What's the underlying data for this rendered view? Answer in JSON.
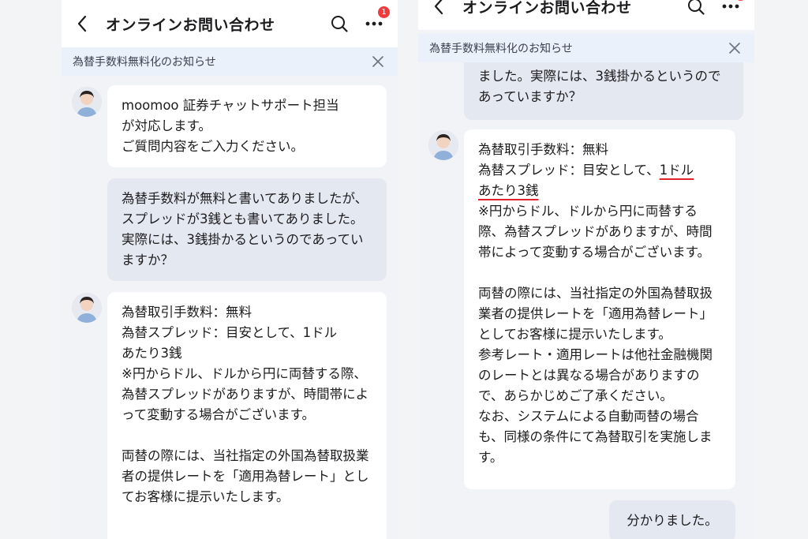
{
  "header": {
    "title": "オンラインお問い合わせ",
    "notification_count": "1"
  },
  "notice": {
    "text": "為替手数料無料化のお知らせ"
  },
  "left_chat": {
    "agent_greeting": "moomoo 証券チャットサポート担当\nが対応します。\n ご質問内容をご入力ください。",
    "user_question": "為替手数料が無料と書いてありましたが、スプレッドが3銭とも書いてありました。実際には、3銭掛かるというのであっていますか？",
    "agent_answer_partial": "為替取引手数料：無料\n為替スプレッド：目安として、1ドル\nあたり3銭\n※円からドル、ドルから円に両替する際、為替スプレッドがありますが、時間帯によって変動する場合がございます。\n\n両替の際には、当社指定の外国為替取扱業者の提供レートを「適用為替レート」としてお客様に提示いたします。"
  },
  "right_chat": {
    "user_question_tail": "ました。実際には、3銭掛かるというのであっていますか？",
    "answer_line1": "為替取引手数料：無料",
    "answer_line2_prefix": "為替スプレッド：目安として、",
    "answer_highlight_part1": "1ドル",
    "answer_highlight_part2": "あたり3銭",
    "answer_rest": "※円からドル、ドルから円に両替する際、為替スプレッドがありますが、時間帯によって変動する場合がございます。\n\n両替の際には、当社指定の外国為替取扱業者の提供レートを「適用為替レート」としてお客様に提示いたします。\n参考レート・適用レートは他社金融機関のレートとは異なる場合がありますので、あらかじめご了承ください。\nなお、システムによる自動両替の場合も、同様の条件にて為替取引を実施します。",
    "user_reply": "分かりました。"
  },
  "colors": {
    "highlight_underline": "#e0242b",
    "badge": "#ef3b3b",
    "notice_bg": "#eaf1fb"
  }
}
